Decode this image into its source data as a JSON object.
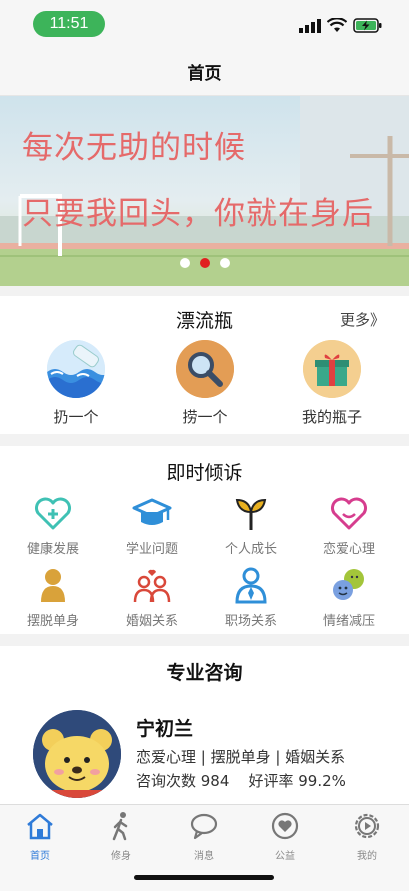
{
  "status": {
    "time": "11:51"
  },
  "nav": {
    "title": "首页"
  },
  "banner": {
    "line1": "每次无助的时候",
    "line2": "只要我回头，你就在身后",
    "dots_total": 3,
    "dots_active_index": 1
  },
  "drift": {
    "title": "漂流瓶",
    "more": "更多》",
    "items": [
      {
        "label": "扔一个",
        "icon": "bottle-wave-icon"
      },
      {
        "label": "捞一个",
        "icon": "magnifier-icon"
      },
      {
        "label": "我的瓶子",
        "icon": "gift-box-icon"
      }
    ]
  },
  "talk": {
    "title": "即时倾诉",
    "items": [
      {
        "label": "健康发展",
        "icon": "heart-plus-icon",
        "color": "#3fc1b4"
      },
      {
        "label": "学业问题",
        "icon": "graduation-cap-icon",
        "color": "#2f8fd8"
      },
      {
        "label": "个人成长",
        "icon": "sprout-icon",
        "color": "#e8b020"
      },
      {
        "label": "恋爱心理",
        "icon": "smile-heart-icon",
        "color": "#d63d8e"
      },
      {
        "label": "摆脱单身",
        "icon": "single-person-icon",
        "color": "#d9a23a"
      },
      {
        "label": "婚姻关系",
        "icon": "couple-icon",
        "color": "#d9483a"
      },
      {
        "label": "职场关系",
        "icon": "business-person-icon",
        "color": "#2f8fd8"
      },
      {
        "label": "情绪减压",
        "icon": "emoji-faces-icon",
        "color": "#a3c53a"
      }
    ]
  },
  "consult": {
    "title": "专业咨询",
    "counselor": {
      "name": "宁初兰",
      "tags": "恋爱心理 | 摆脱单身 | 婚姻关系",
      "stats": "咨询次数 984    好评率 99.2%"
    }
  },
  "tabs": [
    {
      "label": "首页",
      "icon": "home-icon",
      "active": true
    },
    {
      "label": "修身",
      "icon": "walking-person-icon",
      "active": false
    },
    {
      "label": "消息",
      "icon": "chat-bubble-icon",
      "active": false
    },
    {
      "label": "公益",
      "icon": "heart-badge-icon",
      "active": false
    },
    {
      "label": "我的",
      "icon": "gear-icon",
      "active": false
    }
  ]
}
